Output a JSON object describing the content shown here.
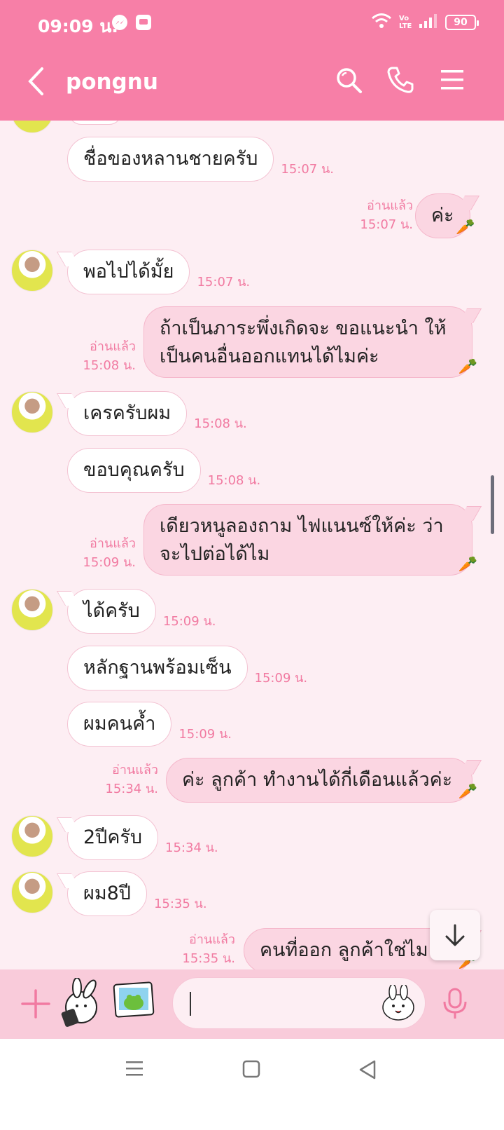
{
  "status": {
    "time": "09:09 น.",
    "battery": "90",
    "network_label": "Vo LTE"
  },
  "header": {
    "title": "pongnu"
  },
  "messages": {
    "m1": {
      "text": "ชื่อของหลานชายครับ",
      "time": "15:07 น."
    },
    "m2": {
      "text": "ค่ะ",
      "read": "อ่านแล้ว",
      "time": "15:07 น."
    },
    "m3": {
      "text": "พอไปได้มั้ย",
      "time": "15:07 น."
    },
    "m4": {
      "line1": "ถ้าเป็นภาระพึ่งเกิดจะ ขอแนะนำ ให้",
      "line2": "เป็นคนอื่นออกแทนได้ไมค่ะ",
      "read": "อ่านแล้ว",
      "time": "15:08 น."
    },
    "m5": {
      "text": "เครครับผม",
      "time": "15:08 น."
    },
    "m6": {
      "text": "ขอบคุณครับ",
      "time": "15:08 น."
    },
    "m7": {
      "line1": "เดียวหนูลองถาม ไฟแนนซ์ให้ค่ะ ว่า",
      "line2": "จะไปต่อได้ไม",
      "read": "อ่านแล้ว",
      "time": "15:09 น."
    },
    "m8": {
      "text": "ได้ครับ",
      "time": "15:09 น."
    },
    "m9": {
      "text": "หลักฐานพร้อมเซ็น",
      "time": "15:09 น."
    },
    "m10": {
      "text": "ผมคนค้ำ",
      "time": "15:09 น."
    },
    "m11": {
      "text": "ค่ะ ลูกค้า ทำงานได้กี่เดือนแล้วค่ะ",
      "read": "อ่านแล้ว",
      "time": "15:34 น."
    },
    "m12": {
      "text": "2ปีครับ",
      "time": "15:34 น."
    },
    "m13": {
      "text": "ผม8ปี",
      "time": "15:35 น."
    },
    "m14": {
      "text": "คนที่ออก ลูกค้าใช่ไม",
      "read": "อ่านแล้ว",
      "time": "15:35 น."
    }
  },
  "colors": {
    "header": "#f77fa7",
    "bubble_out": "#fbd6e2",
    "bubble_in": "#ffffff",
    "time": "#f17aa1",
    "input_bar": "#f9cbda"
  }
}
